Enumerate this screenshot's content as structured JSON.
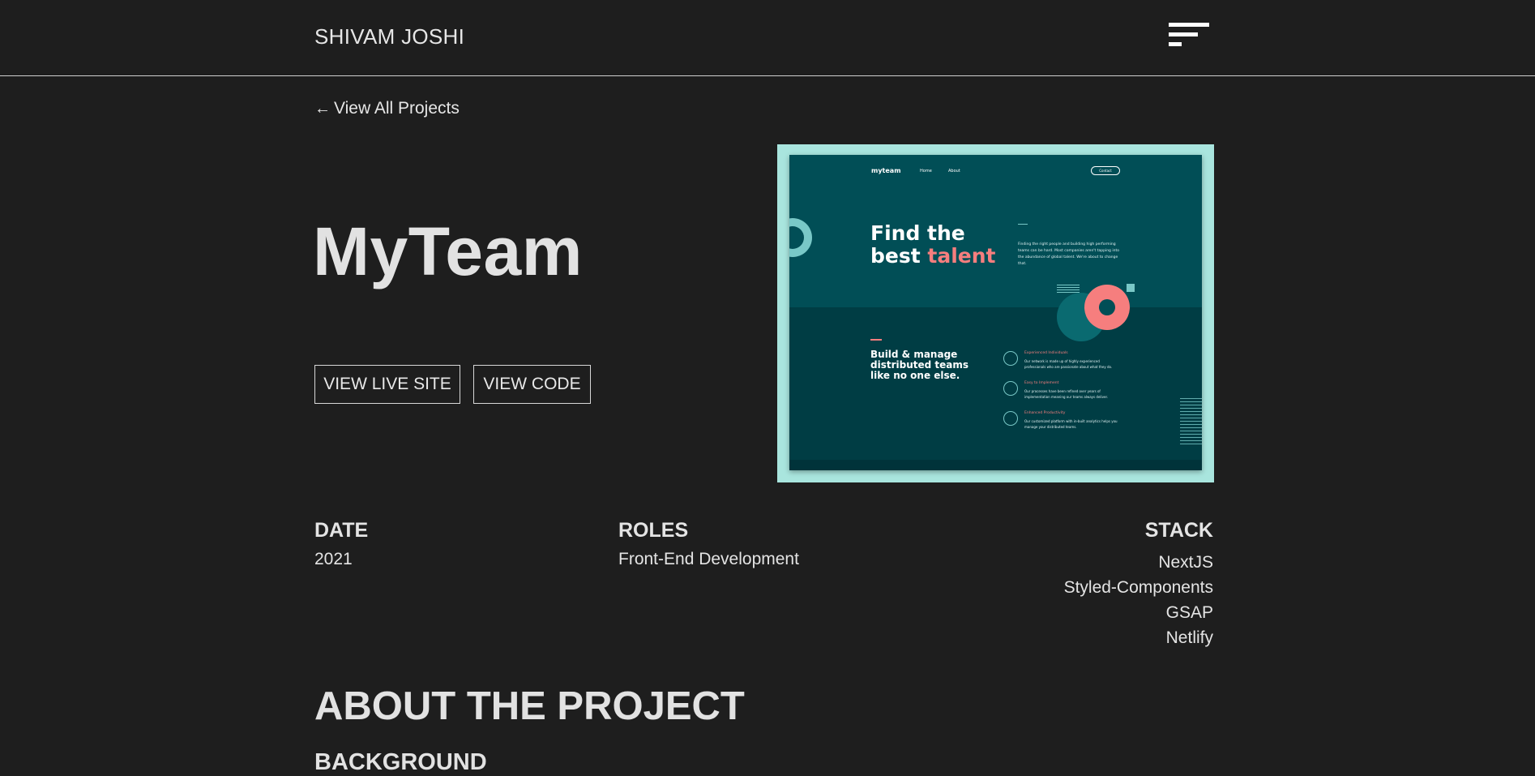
{
  "header": {
    "brand": "SHIVAM JOSHI",
    "menu_icon": "hamburger-menu-icon"
  },
  "back_link": {
    "icon": "arrow-left-icon",
    "arrow": "←",
    "label": "View All Projects"
  },
  "project": {
    "title": "MyTeam",
    "live_label": "VIEW LIVE SITE",
    "code_label": "VIEW CODE"
  },
  "preview": {
    "frame_color": "#a9e5de",
    "mock": {
      "logo": "myteam",
      "nav": [
        "Home",
        "About"
      ],
      "contact": "Contact",
      "hero_line1": "Find the",
      "hero_line2_a": "best ",
      "hero_line2_b": "talent",
      "hero_text": "Finding the right people and building high performing teams can be hard. Most companies aren't tapping into the abundance of global talent. We're about to change that.",
      "build_line1": "Build & manage",
      "build_line2": "distributed teams",
      "build_line3": "like no one else.",
      "features": [
        {
          "title": "Experienced Individuals",
          "desc": "Our network is made up of highly experienced professionals who are passionate about what they do."
        },
        {
          "title": "Easy to Implement",
          "desc": "Our processes have been refined over years of implementation meaning our teams always deliver."
        },
        {
          "title": "Enhanced Productivity",
          "desc": "Our customized platform with in-built analytics helps you manage your distributed teams."
        }
      ]
    }
  },
  "meta": {
    "date_heading": "DATE",
    "date_value": "2021",
    "roles_heading": "ROLES",
    "roles_value": "Front-End Development",
    "stack_heading": "STACK",
    "stack": [
      "NextJS",
      "Styled-Components",
      "GSAP",
      "Netlify"
    ]
  },
  "about": {
    "heading": "ABOUT THE PROJECT",
    "subheading": "BACKGROUND"
  },
  "colors": {
    "page_bg": "#1e1e1e",
    "text": "#e4e4e4",
    "mock_teal": "#014e56",
    "mock_dark": "#003d44",
    "mock_accent": "#f67e7e",
    "mock_light": "#79c8c7"
  }
}
